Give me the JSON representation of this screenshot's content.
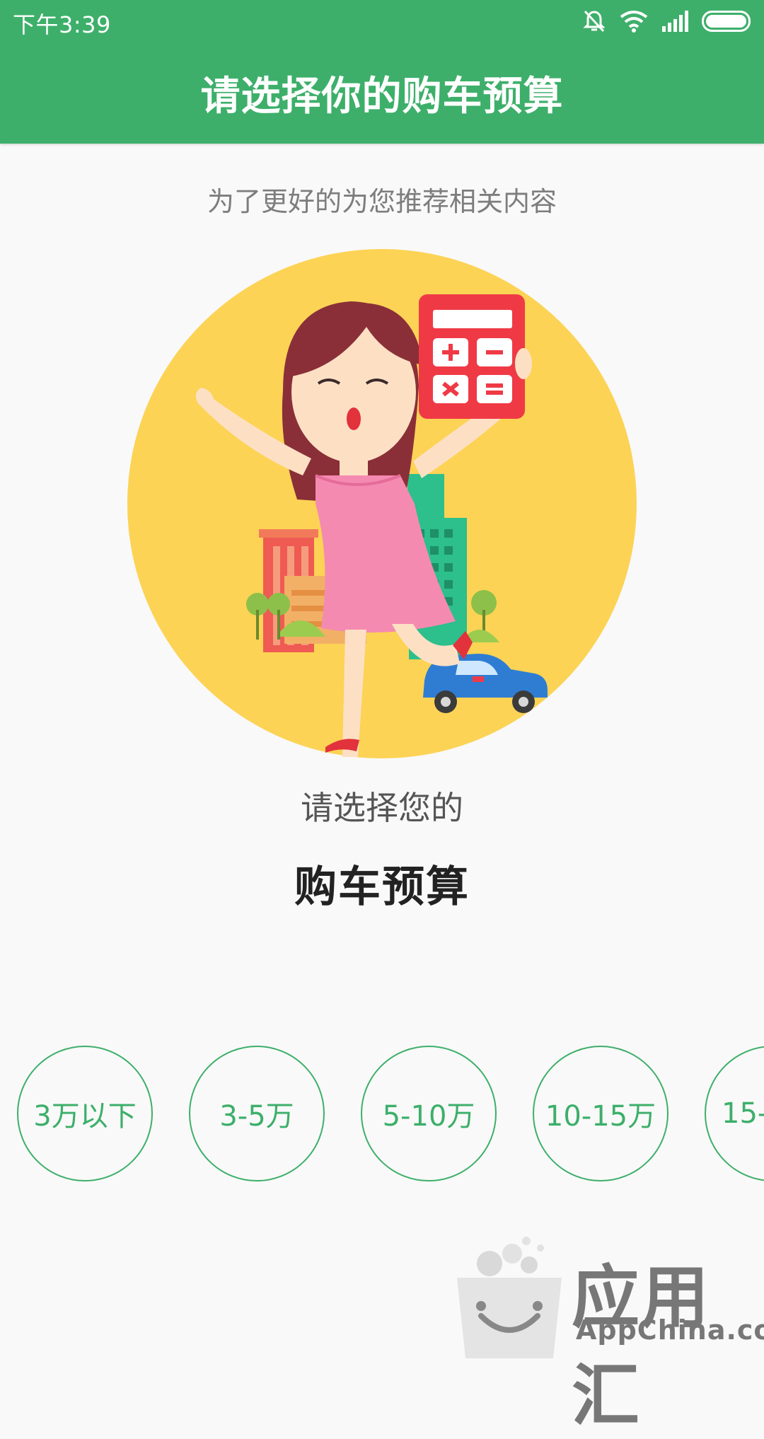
{
  "status_bar": {
    "time": "下午3:39",
    "icons": [
      "mute-icon",
      "wifi-icon",
      "signal-icon",
      "battery-icon"
    ]
  },
  "header": {
    "title": "请选择你的购车预算"
  },
  "subtitle": "为了更好的为您推荐相关内容",
  "hero": {
    "icon": "budget-illustration"
  },
  "prompt": {
    "line1": "请选择您的",
    "line2": "购车预算"
  },
  "budget_options": [
    {
      "label": "3万以下"
    },
    {
      "label": "3-5万"
    },
    {
      "label": "5-10万"
    },
    {
      "label": "10-15万"
    },
    {
      "label": "15-"
    }
  ],
  "watermark": {
    "cn": "应用汇",
    "en": "AppChina.com"
  },
  "colors": {
    "brand_green": "#3daf6a",
    "circle_yellow": "#fcd355",
    "calculator_red": "#ef3a46",
    "dress_pink": "#f58ab1",
    "car_blue": "#2f7dd3"
  }
}
